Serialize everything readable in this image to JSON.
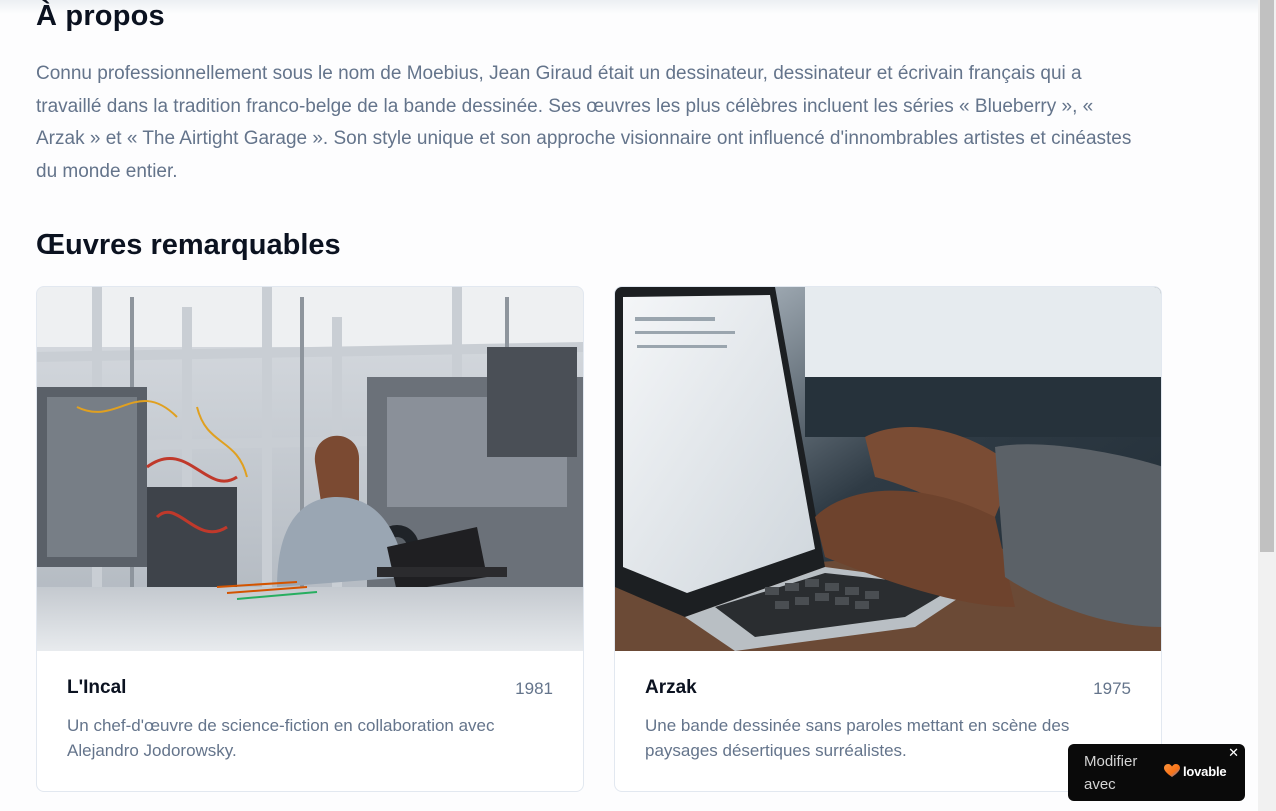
{
  "about": {
    "title": "À propos",
    "text": "Connu professionnellement sous le nom de Moebius, Jean Giraud était un dessinateur, dessinateur et écrivain français qui a travaillé dans la tradition franco-belge de la bande dessinée. Ses œuvres les plus célèbres incluent les séries « Blueberry », « Arzak » et « The Airtight Garage ». Son style unique et son approche visionnaire ont influencé d'innombrables artistes et cinéastes du monde entier."
  },
  "works": {
    "title": "Œuvres remarquables",
    "cards": [
      {
        "title": "L'Incal",
        "year": "1981",
        "description": "Un chef-d'œuvre de science-fiction en collaboration avec Alejandro Jodorowsky.",
        "image_icon": "lab-photo"
      },
      {
        "title": "Arzak",
        "year": "1975",
        "description": "Une bande dessinée sans paroles mettant en scène des paysages désertiques surréalistes.",
        "image_icon": "laptop-typing-photo"
      }
    ]
  },
  "badge": {
    "label": "Modifier avec",
    "brand": "lovable",
    "close": "✕",
    "heart_color": "#f97316"
  }
}
